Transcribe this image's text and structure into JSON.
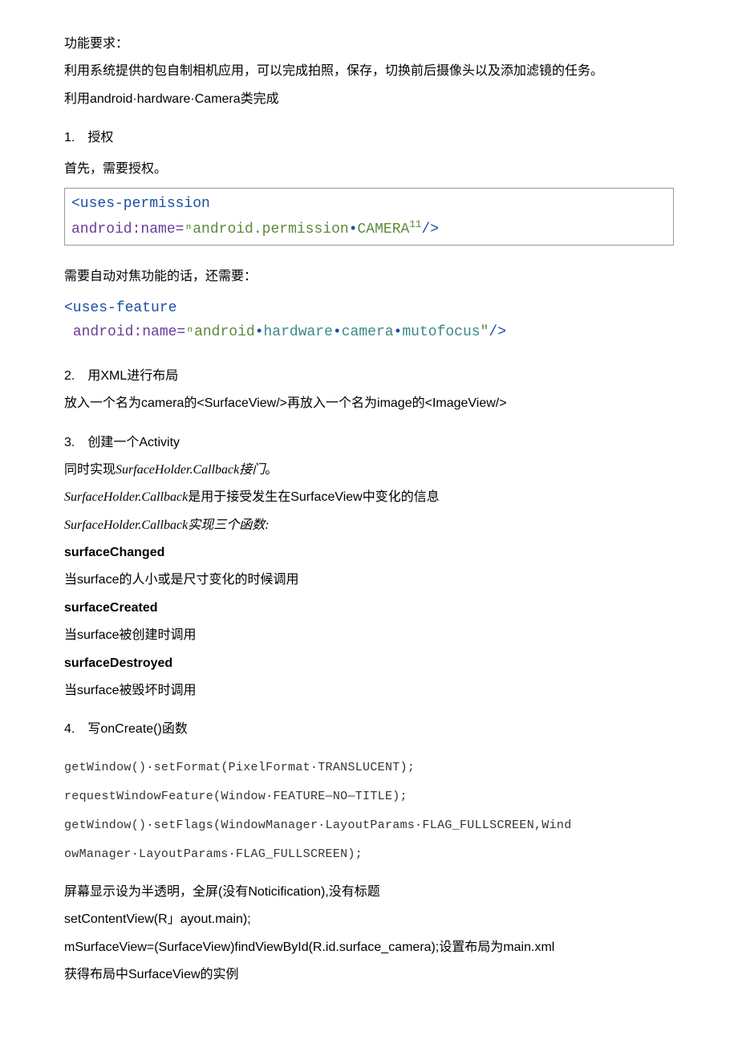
{
  "intro": {
    "title": "功能要求：",
    "line1": "利用系统提供的包自制相机应用，可以完成拍照，保存，切换前后摄像头以及添加滤镜的任务。",
    "line2_prefix": "利用android",
    "line2_mid1": "hardware",
    "line2_mid2": "Camera类完成",
    "dot": "·"
  },
  "s1": {
    "heading": "1.　授权",
    "desc": "首先，需要授权。",
    "code": {
      "indent": "   ",
      "tag_open": "<uses-permission",
      "attr_name": "android:name=",
      "quote_open": "ⁿ",
      "value": "android.permission",
      "value_dot": "•",
      "value2": "CAMERA",
      "sup": "11",
      "tag_close": "/>"
    },
    "after": "需要自动对焦功能的话，还需要：",
    "code2": {
      "indent": "   ",
      "tag_open": "<uses-feature",
      "attr_name": "android:name=",
      "quote_open": "ⁿ",
      "value_parts": [
        "android",
        "hardware",
        "camera",
        "mutofocus"
      ],
      "dot": "•",
      "quote_close": "″",
      "tag_close": "/>"
    }
  },
  "s2": {
    "heading": "2.　用XML进行布局",
    "desc": "放入一个名为camera的<SurfaceView/>再放入一个名为image的<ImageView/>"
  },
  "s3": {
    "heading": "3.　创建一个Activity",
    "line1_pre": "同时实现",
    "line1_ital": "SurfaceHolder.Callback接门",
    "line1_suf": "。",
    "line2_ital": "SurfaceHolder.Callback",
    "line2_suf": "是用于接受发生在SurfaceView中变化的信息",
    "line3_ital": "SurfaceHolder.Callback实现三个函数:",
    "fn1": "surfaceChanged",
    "fn1_desc": "当surface的人小或是尺寸变化的时候调用",
    "fn2": "surfaceCreated",
    "fn2_desc": "当surface被创建时调用",
    "fn3": "surfaceDestroyed",
    "fn3_desc": "当surface被毁坏时调用"
  },
  "s4": {
    "heading": "4.　写onCreate()函数",
    "code_line1": "getWindow()·setFormat(PixelFormat·TRANSLUCENT);",
    "code_line2": "requestWindowFeature(Window·FEATURE—NO—TITLE);",
    "code_line3": "getWindow()·setFlags(WindowManager·LayoutParams·FLAG_FULLSCREEN,Wind",
    "code_line4": "owManager·LayoutParams·FLAG_FULLSCREEN);",
    "desc1": "屏幕显示设为半透明，全屏(没有Noticification),没有标题",
    "desc2": "setContentView(R」ayout.main);",
    "desc3": "mSurfaceView=(SurfaceView)findViewById(R.id.surface_camera);设置布局为main.xml",
    "desc4": "获得布局中SurfaceView的实例"
  }
}
